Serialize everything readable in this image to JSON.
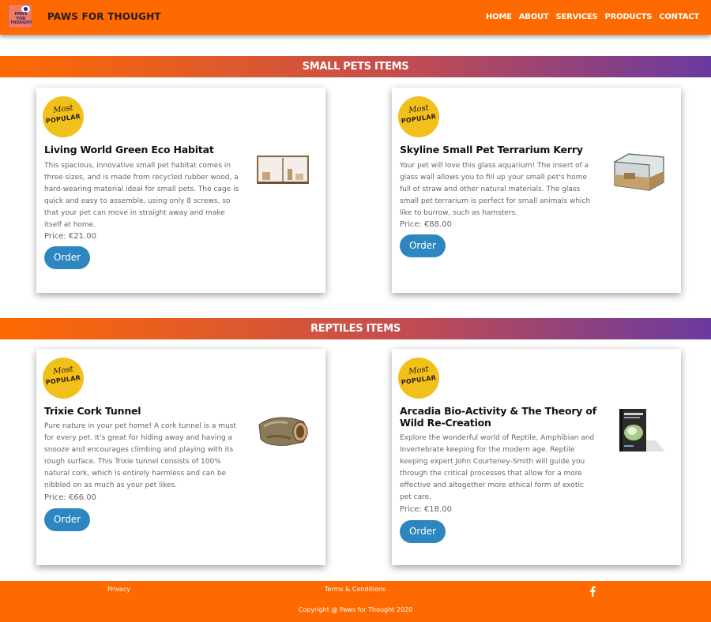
{
  "brand": {
    "logo_text": "PAWS FOR THOUGHT",
    "name": "PAWS FOR THOUGHT"
  },
  "nav": {
    "items": [
      "HOME",
      "ABOUT",
      "SERVICES",
      "PRODUCTS",
      "CONTACT"
    ]
  },
  "badge": {
    "line1": "Most",
    "line2": "POPULAR"
  },
  "order_label": "Order",
  "sections": [
    {
      "title": "SMALL PETS ITEMS",
      "products": [
        {
          "title": "Living World Green Eco Habitat",
          "description": "This spacious, innovative small pet habitat comes in three sizes, and is made from recycled rubber wood, a hard-wearing material ideal for small pets. The cage is quick and easy to assemble, using only 8 screws, so that your pet can move in straight away and make itself at home.",
          "price": "Price: €21.00"
        },
        {
          "title": "Skyline Small Pet Terrarium Kerry",
          "description": "Your pet will love this glass aquarium! The insert of a glass wall allows you to fill up your small pet's home full of straw and other natural materials. The glass small pet terrarium is perfect for small animals which like to burrow, such as hamsters.",
          "price": "Price: €88.00"
        }
      ]
    },
    {
      "title": "REPTILES ITEMS",
      "products": [
        {
          "title": "Trixie Cork Tunnel",
          "description": "Pure nature in your pet home! A cork tunnel is a must for every pet. It's great for hiding away and having a snooze and encourages climbing and playing with its rough surface. This Trixie tunnel consists of 100% natural cork, which is entirely harmless and can be nibbled on as much as your pet likes.",
          "price": "Price: €66.00"
        },
        {
          "title": "Arcadia Bio-Activity & The Theory of Wild Re-Creation",
          "description": "Explore the wonderful world of Reptile, Amphibian and Invertebrate keeping for the modern age. Reptile keeping expert John Courteney-Smith will guide you through the critical processes that allow for a more effective and altogether more ethical form of exotic pet care.",
          "price": "Price: €18.00"
        }
      ]
    }
  ],
  "footer": {
    "privacy": "Privacy",
    "terms": "Terms & Conditions",
    "social_icon": "facebook-icon",
    "copyright": "Copyright @ Paws for Thought 2020"
  },
  "colors": {
    "primary": "#ff6a00",
    "button": "#2e86c1",
    "badge": "#f2c01a",
    "gradient_end": "#6a3aa0"
  }
}
